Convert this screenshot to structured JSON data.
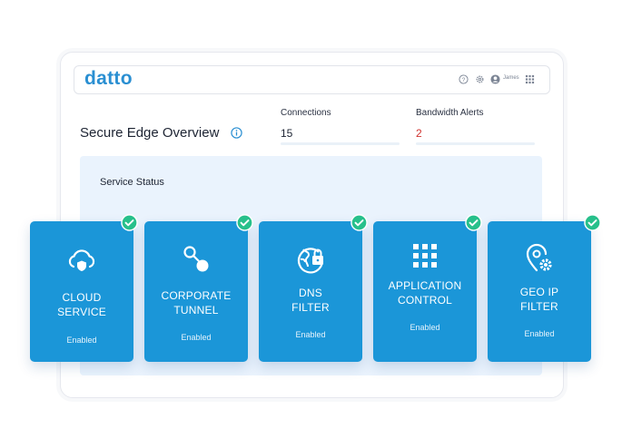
{
  "header": {
    "logo": "datto",
    "user": "James",
    "colors": {
      "brand": "#2a8fd2"
    }
  },
  "overview": {
    "title": "Secure Edge Overview",
    "stats": [
      {
        "label": "Connections",
        "value": "15",
        "color": "#1d2433"
      },
      {
        "label": "Bandwidth Alerts",
        "value": "2",
        "color": "#d0312d"
      }
    ]
  },
  "service_status": {
    "title": "Service Status",
    "services": [
      {
        "name_lines": [
          "CLOUD",
          "SERVICE"
        ],
        "status": "Enabled",
        "icon": "cloud-shield-icon"
      },
      {
        "name_lines": [
          "CORPORATE",
          "TUNNEL"
        ],
        "status": "Enabled",
        "icon": "tunnel-link-icon"
      },
      {
        "name_lines": [
          "DNS",
          "FILTER"
        ],
        "status": "Enabled",
        "icon": "globe-lock-icon"
      },
      {
        "name_lines": [
          "APPLICATION",
          "CONTROL"
        ],
        "status": "Enabled",
        "icon": "app-grid-icon"
      },
      {
        "name_lines": [
          "GEO IP",
          "FILTER"
        ],
        "status": "Enabled",
        "icon": "location-gear-icon"
      }
    ],
    "colors": {
      "card": "#1b96d8",
      "check": "#27c08b",
      "panel": "#eaf3fd"
    }
  }
}
